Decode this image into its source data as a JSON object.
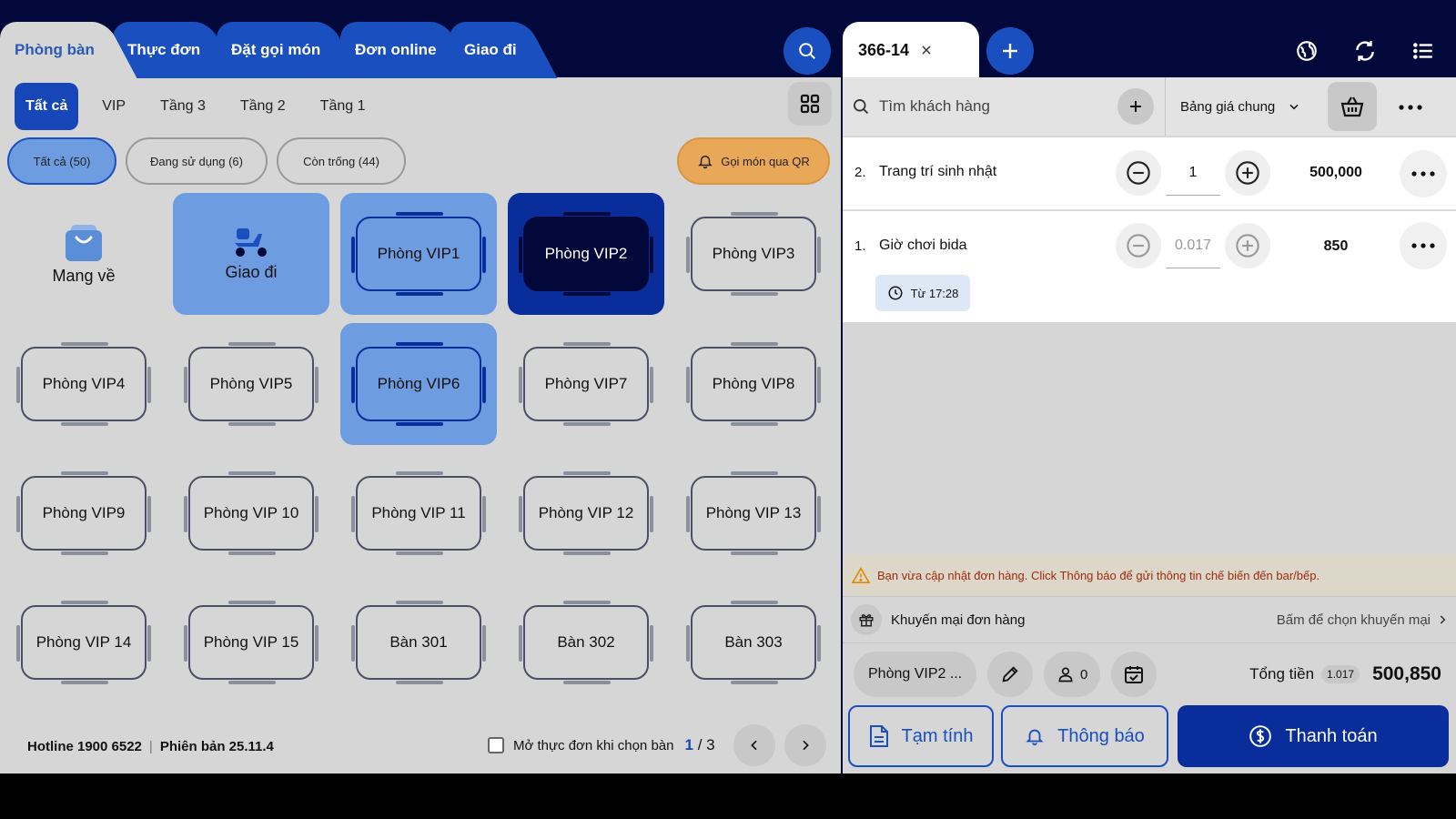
{
  "left": {
    "tabs": [
      {
        "label": "Phòng bàn",
        "active": true
      },
      {
        "label": "Thực đơn"
      },
      {
        "label": "Đặt gọi món"
      },
      {
        "label": "Đơn online"
      },
      {
        "label": "Giao đi"
      }
    ],
    "floors": [
      "Tất cả",
      "VIP",
      "Tầng 3",
      "Tầng 2",
      "Tầng 1"
    ],
    "filters": [
      "Tất cả (50)",
      "Đang sử dụng (6)",
      "Còn trống (44)"
    ],
    "qr_label": "Gọi món qua QR",
    "special": {
      "takeaway": "Mang về",
      "delivery": "Giao đi"
    },
    "tables": [
      "Phòng VIP1",
      "Phòng VIP2",
      "Phòng VIP3",
      "Phòng VIP4",
      "Phòng VIP5",
      "Phòng VIP6",
      "Phòng VIP7",
      "Phòng VIP8",
      "Phòng VIP9",
      "Phòng VIP 10",
      "Phòng VIP 11",
      "Phòng VIP 12",
      "Phòng VIP 13",
      "Phòng VIP 14",
      "Phòng VIP 15",
      "Bàn 301",
      "Bàn 302",
      "Bàn 303"
    ],
    "footer": {
      "hotline": "Hotline 1900 6522",
      "version": "Phiên bản 25.11.4",
      "open_menu_label": "Mở thực đơn khi chọn bàn",
      "page_current": "1",
      "page_sep": "/",
      "page_total": "3"
    }
  },
  "right": {
    "order_tab": "366-14",
    "customer_placeholder": "Tìm khách hàng",
    "price_list": "Bảng giá chung",
    "items": [
      {
        "index": "2.",
        "name": "Trang trí sinh nhật",
        "qty": "1",
        "price": "500,000"
      },
      {
        "index": "1.",
        "name": "Giờ chơi bida",
        "qty": "0.017",
        "price": "850",
        "time": "Từ 17:28"
      }
    ],
    "warning": "Bạn vừa cập nhật đơn hàng. Click Thông báo để gửi thông tin chế biến đến bar/bếp.",
    "promo_label": "Khuyến mại đơn hàng",
    "promo_action": "Bấm để chọn khuyến mại",
    "room": "Phòng VIP2 ...",
    "guests": "0",
    "total_label": "Tổng tiền",
    "total_qty": "1.017",
    "total_value": "500,850",
    "actions": {
      "provisional": "Tạm tính",
      "notify": "Thông báo",
      "pay": "Thanh toán"
    }
  },
  "colors": {
    "navy": "#02093a",
    "primary": "#1a4fc0",
    "selected": "#6d9ce0",
    "dark_selected": "#0a2d9c",
    "warning_text": "#a02a10",
    "qr": "#e8a857"
  }
}
